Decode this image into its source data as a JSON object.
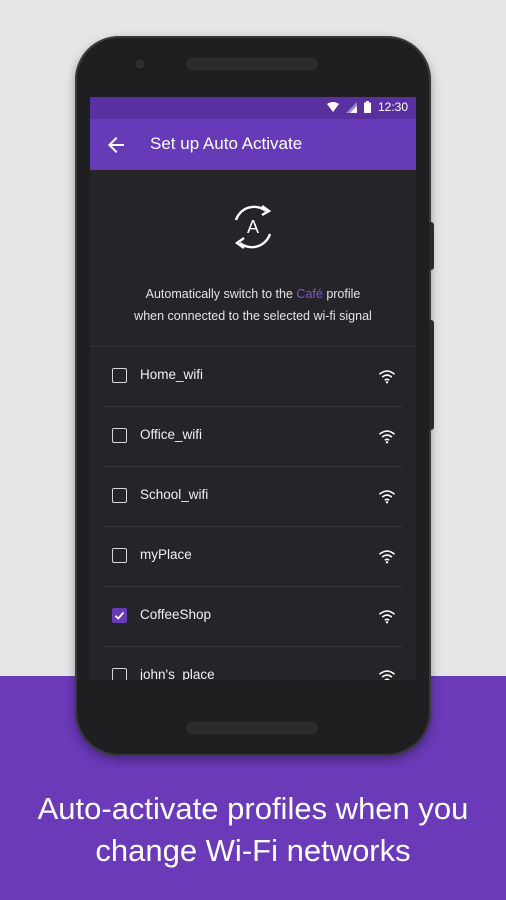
{
  "status_bar": {
    "time": "12:30"
  },
  "app_bar": {
    "title": "Set up Auto Activate"
  },
  "auto_icon_letter": "A",
  "description": {
    "line1_prefix": "Automatically switch to the",
    "profile_name": "Café",
    "line1_suffix": "profile",
    "line2": "when connected to the selected wi-fi signal"
  },
  "networks": [
    {
      "name": "Home_wifi",
      "checked": false
    },
    {
      "name": "Office_wifi",
      "checked": false
    },
    {
      "name": "School_wifi",
      "checked": false
    },
    {
      "name": "myPlace",
      "checked": false
    },
    {
      "name": "CoffeeShop",
      "checked": true
    },
    {
      "name": "john's_place",
      "checked": false
    }
  ],
  "caption": {
    "line1": "Auto-activate profiles when you",
    "line2": "change Wi-Fi networks"
  },
  "colors": {
    "primary": "#673ab7",
    "primary_dark": "#5a2fa0",
    "screen_bg": "#252529",
    "promo_band": "#6a3ab8"
  },
  "icons": {
    "status": [
      "wifi-signal-icon",
      "cell-signal-icon",
      "battery-icon"
    ],
    "back": "arrow-back-icon",
    "auto_activate": "auto-activate-icon",
    "network": "wifi-icon",
    "check": "check-icon"
  }
}
